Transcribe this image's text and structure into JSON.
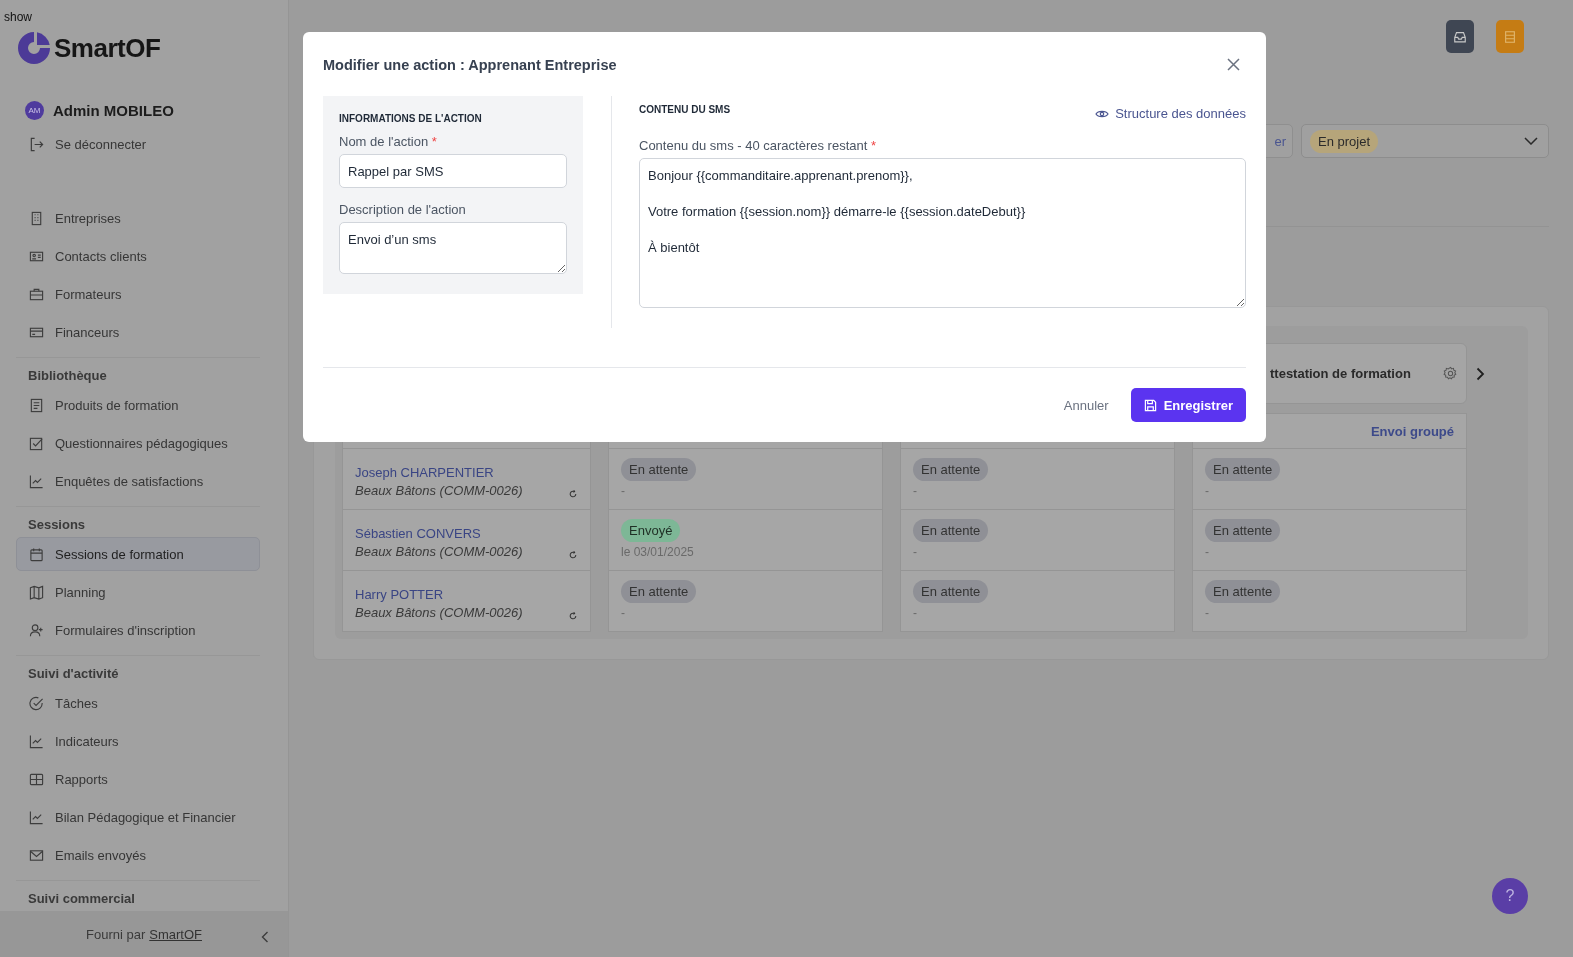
{
  "debug_label": "show",
  "brand": {
    "name": "SmartOF"
  },
  "user": {
    "initials": "AM",
    "name": "Admin MOBILEO",
    "logout": "Se déconnecter"
  },
  "nav_sections": [
    {
      "items": [
        {
          "label": "Entreprises",
          "kind": "building",
          "selected": false
        },
        {
          "label": "Contacts clients",
          "kind": "idcard",
          "selected": false
        },
        {
          "label": "Formateurs",
          "kind": "briefcase",
          "selected": false
        },
        {
          "label": "Financeurs",
          "kind": "card",
          "selected": false
        }
      ]
    },
    {
      "title": "Bibliothèque",
      "items": [
        {
          "label": "Produits de formation",
          "kind": "doc",
          "selected": false
        },
        {
          "label": "Questionnaires pédagogiques",
          "kind": "checkbox",
          "selected": false
        },
        {
          "label": "Enquêtes de satisfactions",
          "kind": "chart",
          "selected": false
        }
      ]
    },
    {
      "title": "Sessions",
      "items": [
        {
          "label": "Sessions de formation",
          "kind": "calendar",
          "selected": true
        },
        {
          "label": "Planning",
          "kind": "map",
          "selected": false
        },
        {
          "label": "Formulaires d'inscription",
          "kind": "useradd",
          "selected": false
        }
      ]
    },
    {
      "title": "Suivi d'activité",
      "items": [
        {
          "label": "Tâches",
          "kind": "checkcircle",
          "selected": false
        },
        {
          "label": "Indicateurs",
          "kind": "chart",
          "selected": false
        },
        {
          "label": "Rapports",
          "kind": "grid",
          "selected": false
        },
        {
          "label": "Bilan Pédagogique et Financier",
          "kind": "chart",
          "selected": false
        },
        {
          "label": "Emails envoyés",
          "kind": "mail",
          "selected": false
        }
      ]
    },
    {
      "title": "Suivi commercial"
    }
  ],
  "sidebar_footer": {
    "text": "Fourni par",
    "link": "SmartOF"
  },
  "filters": {
    "button_fragment": "er",
    "status": "En projet"
  },
  "board": {
    "column_title": "ttestation de formation",
    "group_send": "Envoi groupé",
    "rows": [
      {
        "name": "Joseph CHARPENTIER",
        "company": "Beaux Bâtons (COMM-0026)",
        "cells": [
          {
            "status": "En attente",
            "kind": "pending",
            "date": "-"
          },
          {
            "status": "En attente",
            "kind": "pending",
            "date": "-"
          },
          {
            "status": "En attente",
            "kind": "pending",
            "date": "-"
          }
        ]
      },
      {
        "name": "Sébastien CONVERS",
        "company": "Beaux Bâtons (COMM-0026)",
        "cells": [
          {
            "status": "Envoyé",
            "kind": "sent",
            "date": "le 03/01/2025"
          },
          {
            "status": "En attente",
            "kind": "pending",
            "date": "-"
          },
          {
            "status": "En attente",
            "kind": "pending",
            "date": "-"
          }
        ]
      },
      {
        "name": "Harry POTTER",
        "company": "Beaux Bâtons (COMM-0026)",
        "cells": [
          {
            "status": "En attente",
            "kind": "pending",
            "date": "-"
          },
          {
            "status": "En attente",
            "kind": "pending",
            "date": "-"
          },
          {
            "status": "En attente",
            "kind": "pending",
            "date": "-"
          }
        ]
      }
    ]
  },
  "modal": {
    "title": "Modifier une action : Apprenant Entreprise",
    "info": {
      "heading": "INFORMATIONS DE L'ACTION",
      "name_field": {
        "label": "Nom de l'action",
        "required_mark": "*",
        "value": "Rappel par SMS"
      },
      "description_field": {
        "label": "Description de l'action",
        "value": "Envoi d’un sms"
      }
    },
    "sms": {
      "heading": "CONTENU DU SMS",
      "data_link": "Structure des données",
      "content_field": {
        "label": "Contenu du sms - 40 caractères restant",
        "required_mark": "*",
        "value": "Bonjour {{commanditaire.apprenant.prenom}},\n\nVotre formation {{session.nom}} démarre-le {{session.dateDebut}}\n\nÀ bientôt"
      }
    },
    "cancel": "Annuler",
    "save": "Enregistrer"
  },
  "help_button": "?"
}
